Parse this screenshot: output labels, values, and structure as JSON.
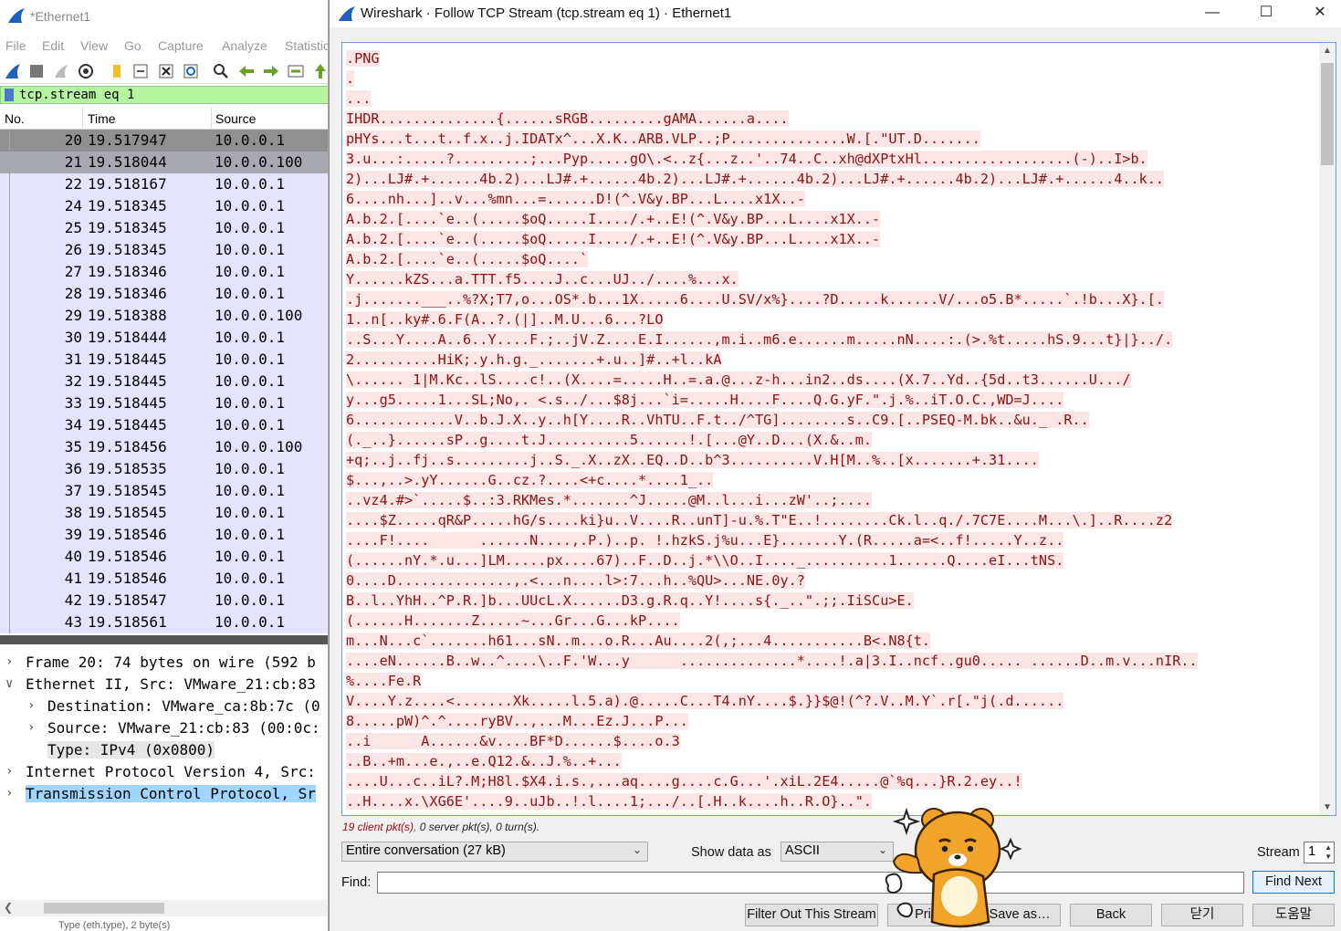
{
  "main_window": {
    "title": "*Ethernet1",
    "menu": [
      "File",
      "Edit",
      "View",
      "Go",
      "Capture",
      "Analyze",
      "Statistic"
    ],
    "filter_text": "tcp.stream eq 1",
    "columns": [
      "No.",
      "Time",
      "Source"
    ],
    "packets": [
      {
        "no": "20",
        "time": "19.517947",
        "src": "10.0.0.1"
      },
      {
        "no": "21",
        "time": "19.518044",
        "src": "10.0.0.100"
      },
      {
        "no": "22",
        "time": "19.518167",
        "src": "10.0.0.1"
      },
      {
        "no": "24",
        "time": "19.518345",
        "src": "10.0.0.1"
      },
      {
        "no": "25",
        "time": "19.518345",
        "src": "10.0.0.1"
      },
      {
        "no": "26",
        "time": "19.518345",
        "src": "10.0.0.1"
      },
      {
        "no": "27",
        "time": "19.518346",
        "src": "10.0.0.1"
      },
      {
        "no": "28",
        "time": "19.518346",
        "src": "10.0.0.1"
      },
      {
        "no": "29",
        "time": "19.518388",
        "src": "10.0.0.100"
      },
      {
        "no": "30",
        "time": "19.518444",
        "src": "10.0.0.1"
      },
      {
        "no": "31",
        "time": "19.518445",
        "src": "10.0.0.1"
      },
      {
        "no": "32",
        "time": "19.518445",
        "src": "10.0.0.1"
      },
      {
        "no": "33",
        "time": "19.518445",
        "src": "10.0.0.1"
      },
      {
        "no": "34",
        "time": "19.518445",
        "src": "10.0.0.1"
      },
      {
        "no": "35",
        "time": "19.518456",
        "src": "10.0.0.100"
      },
      {
        "no": "36",
        "time": "19.518535",
        "src": "10.0.0.1"
      },
      {
        "no": "37",
        "time": "19.518545",
        "src": "10.0.0.1"
      },
      {
        "no": "38",
        "time": "19.518545",
        "src": "10.0.0.1"
      },
      {
        "no": "39",
        "time": "19.518546",
        "src": "10.0.0.1"
      },
      {
        "no": "40",
        "time": "19.518546",
        "src": "10.0.0.1"
      },
      {
        "no": "41",
        "time": "19.518546",
        "src": "10.0.0.1"
      },
      {
        "no": "42",
        "time": "19.518547",
        "src": "10.0.0.1"
      },
      {
        "no": "43",
        "time": "19.518561",
        "src": "10.0.0.1"
      }
    ],
    "details": [
      {
        "arrow": ">",
        "text": "Frame 20: 74 bytes on wire (592 b"
      },
      {
        "arrow": "v",
        "text": "Ethernet II, Src: VMware_21:cb:83"
      },
      {
        "arrow": ">",
        "text": "Destination: VMware_ca:8b:7c (0"
      },
      {
        "arrow": ">",
        "text": "Source: VMware_21:cb:83 (00:0c:"
      },
      {
        "arrow": "",
        "text": "Type: IPv4 (0x0800)"
      },
      {
        "arrow": ">",
        "text": "Internet Protocol Version 4, Src:"
      },
      {
        "arrow": ">",
        "text": "Transmission Control Protocol, Sr"
      }
    ],
    "status_text": "Type (eth.type), 2 byte(s)"
  },
  "dialog": {
    "title": "Wireshark · Follow TCP Stream (tcp.stream eq 1) · Ethernet1",
    "stream_lines": [
      ".PNG",
      ".",
      "...",
      "IHDR..............{......sRGB.........gAMA......a....",
      "pHYs...t...t..f.x..j.IDATx^...X.K..ARB.VLP..;P..............W.[.\"UT.D.......",
      "3.u...:.....?.........;...Pyp.....gO\\.<..z{...z..'..74..C..xh@dXPtxHl..................(-)..I>b.",
      "2)...LJ#.+......4b.2)...LJ#.+......4b.2)...LJ#.+......4b.2)...LJ#.+......4b.2)...LJ#.+......4..k..",
      "6....nh...]..v...%mn...=......D!(^.V&y.BP...L....x1X..-",
      "A.b.2.[....`e..(.....$oQ.....I..../.+..E!(^.V&y.BP...L....x1X..-",
      "A.b.2.[....`e..(.....$oQ.....I..../.+..E!(^.V&y.BP...L....x1X..-",
      "A.b.2.[....`e..(.....$oQ....`",
      "Y......kZS...a.TTT.f5....J..c...UJ../....%...x.",
      ".j.......___..%?X;T7,o...OS*.b...1X.....6....U.SV/x%}....?D.....k......V/...o5.B*.....`.!b...X}.[.",
      "1..n[..ky#.6.F(A..?.(|]..M.U...6...?LO",
      "..S...Y....A..6..Y....F.;..jV.Z....E.I......,m.i..m6.e......m.....nN....:.(>.%t.....hS.9...t}|}../.",
      "2..........HiK;.y.h.g._.......+.u..]#..+l..kA",
      "\\...... 1|M.Kc..lS....c!..(X....=.....H..=.a.@...z-h...in2..ds....(X.7..Yd..{5d..t3......U.../",
      "y...g5.....1...SL;No,. <.s../...$8j...`i=.....H....F....Q.G.yF.\".j.%..iT.O.C.,WD=J....",
      "6............V..b.J.X..y..h[Y....R..VhTU..F.t../^TG]........s..C9.[..PSEQ-M.bk..&u._ .R..",
      "(._..}......sP..g....t.J..........5......!.[...@Y..D...(X.&..m.",
      "+q;..j..fj..s.........j..S._.X..zX..EQ..D..b^3..........V.H[M..%..[x.......+.31....",
      "$...,..>.yY......G..cz.?....<+c....*....1_..",
      "..vz4.#>`.....$..:3.RKMes.*.......^J.....@M..l...i...zW'..;....",
      "....$Z.....qR&P.....hG/s....ki}u..V....R..unT]-u.%.T\"E..!........Ck.l..q./.7C7E....M...\\.]..R....z2",
      "....F!....      ......N....,.P.)..p. !.hzkS.j%u...E}.......Y.(R.....a=<..f!.....Y..z..",
      "(......nY.*.u...]LM.....px....67)..F..D..j.*\\\\O..I...._..........1......Q....eI...tNS.",
      "0....D..............,.<...n....l>:7...h..%QU>...NE.0y.?",
      "B..l..YhH..^P.R.]b...UUcL.X......D3.g.R.q..Y!....s{._..\".;;.IiSCu>E.",
      "(......H.......Z.....~...Gr...G...kP....",
      "m...N...c`.......h61...sN..m...o.R...Au....2(,;...4...........B<.N8{t.",
      "....eN......B..w..^....\\..F.'W...y      ..............*....!.a|3.I..ncf..gu0..... ......D..m.v...nIR..",
      "%....Fe.R",
      "V....Y.z....<.......Xk.....l.5.a).@.....C...T4.nY....$.}}$@!(^?.V..M.Y`.r[.\"j(.d......",
      "8.....pW)^.^....ryBV..,...M...Ez.J...P...",
      "..i      A......&v....BF*D......$....o.3",
      "..B..+m...e.,..e.Q12.&..J.%..+...",
      "....U...c..iL?.M;H8l.$X4.i.s.,...aq....g....c.G...'.xiL.2E4.....@`%q...}R.2.ey..!",
      "..H....x.\\XG6E'....9..uJb..!.l....1;.../..[.H..k....h..R.O}..\"."
    ],
    "stats": {
      "client": "19 client pkt(s), ",
      "client_word_color": "#a01010",
      "server": "0 server pkt(s), ",
      "turns": "0 turn(s)."
    },
    "conversation_select": "Entire conversation (27 kB)",
    "show_data_label": "Show data as",
    "show_data_value": "ASCII",
    "stream_label": "Stream",
    "stream_value": "1",
    "find_label": "Find:",
    "find_value": "",
    "find_next": "Find Next",
    "buttons": {
      "filter_out": "Filter Out This Stream",
      "print": "Print",
      "save_as": "Save as…",
      "back": "Back",
      "close": "닫기",
      "help": "도움말"
    },
    "win_controls": {
      "minimize": "—",
      "maximize": "☐",
      "close": "✕"
    }
  }
}
